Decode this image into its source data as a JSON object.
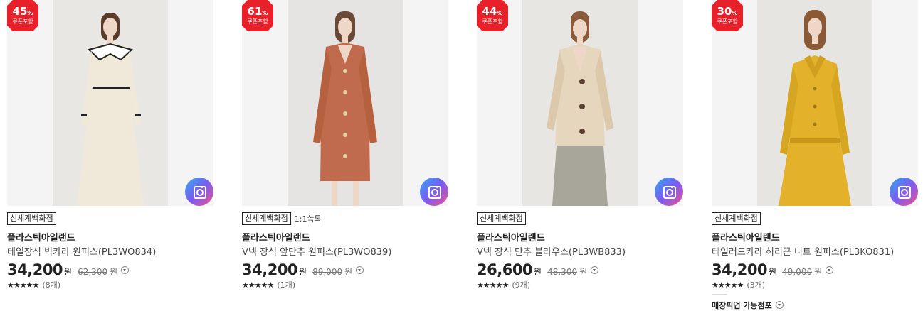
{
  "products": [
    {
      "discount": "45",
      "discount_unit": "%",
      "coupon_label": "쿠폰포함",
      "store": "신세계백화점",
      "extra": "",
      "brand": "플라스틱아일랜드",
      "name": "테일장식 빅카라 원피스(PL3WO834)",
      "price": "34,200",
      "price_unit": "원",
      "original_price": "62,300",
      "original_unit": "원",
      "stars": "★★★★★",
      "review_count": "(8개)",
      "image_icon": "camera-lens-icon",
      "dress_color": "#f0e8d8"
    },
    {
      "discount": "61",
      "discount_unit": "%",
      "coupon_label": "쿠폰포함",
      "store": "신세계백화점",
      "extra": "1:1쓱톡",
      "brand": "플라스틱아일랜드",
      "name": "V넥 장식 앞단추 원피스(PL3WO839)",
      "price": "34,200",
      "price_unit": "원",
      "original_price": "89,000",
      "original_unit": "원",
      "stars": "★★★★★",
      "review_count": "(1개)",
      "image_icon": "camera-lens-icon",
      "dress_color": "#c06a4e"
    },
    {
      "discount": "44",
      "discount_unit": "%",
      "coupon_label": "쿠폰포함",
      "store": "신세계백화점",
      "extra": "",
      "brand": "플라스틱아일랜드",
      "name": "V넥 장식 단추 블라우스(PL3WB833)",
      "price": "26,600",
      "price_unit": "원",
      "original_price": "48,300",
      "original_unit": "원",
      "stars": "★★★★★",
      "review_count": "(9개)",
      "image_icon": "camera-lens-icon",
      "dress_color": "#e6d6bd"
    },
    {
      "discount": "30",
      "discount_unit": "%",
      "coupon_label": "쿠폰포함",
      "store": "신세계백화점",
      "extra": "",
      "brand": "플라스틱아일랜드",
      "name": "테일러드카라 허리끈 니트 원피스(PL3KO831)",
      "price": "34,200",
      "price_unit": "원",
      "original_price": "49,000",
      "original_unit": "원",
      "stars": "★★★★★",
      "review_count": "(3개)",
      "pickup_label": "매장픽업 가능점포",
      "image_icon": "camera-lens-icon",
      "dress_color": "#e3b22a"
    }
  ],
  "colors": {
    "badge_red": "#e8202a",
    "accent_text": "#222222"
  }
}
